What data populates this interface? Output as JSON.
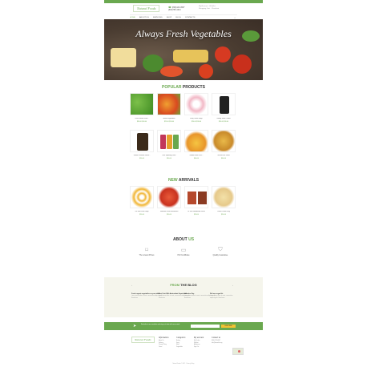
{
  "header": {
    "logo": "Natural Foods",
    "phone_lines": [
      "(800)123-4567",
      "(800)765-4321"
    ],
    "account_lines": [
      "My Account · Wishlist",
      "Shopping Cart · Checkout"
    ]
  },
  "nav": {
    "items": [
      "HOME",
      "ABOUT US",
      "SERVICES",
      "SHOP",
      "BLOG",
      "CONTACTS"
    ],
    "active_index": 0,
    "search_icon": "search-icon"
  },
  "hero": {
    "title": "Always Fresh Vegetables"
  },
  "popular": {
    "title_prefix": "POPULAR",
    "title_suffix": " PRODUCTS",
    "products": [
      {
        "name": "Peas Frozen Grow...",
        "price": "$34.00  $40.00"
      },
      {
        "name": "Mixed Vegetables",
        "price": "$25.00  $30.00"
      },
      {
        "name": "Easy Onion Rings",
        "price": "$24.00  $30.00"
      },
      {
        "name": "Grilling Steak Coffee",
        "price": "$24.00  $30.00"
      },
      {
        "name": "Safina Premium Gourd...",
        "price": "$26.00"
      },
      {
        "name": "Izze Sparkling Juice",
        "price": "$24.00"
      },
      {
        "name": "Golden Hass Pine...",
        "price": "$34.00"
      },
      {
        "name": "Gluten Free Pasta",
        "price": "$34.00"
      }
    ]
  },
  "arrivals": {
    "title_prefix": "NEW",
    "title_suffix": " ARRIVALS",
    "products": [
      {
        "name": "Fat Free Fruit Rings",
        "price": "$26.00"
      },
      {
        "name": "Valentino Pizza Mozzarella",
        "price": "$24.00"
      },
      {
        "name": "Dr Jack Handmade Pasta",
        "price": "$28.00"
      },
      {
        "name": "Penne Pasta Long",
        "price": "$24.00"
      }
    ]
  },
  "about": {
    "title_prefix": "ABOUT",
    "title_suffix": " US",
    "features": [
      {
        "icon": "tag-icon",
        "label": "The Lowest Prices"
      },
      {
        "icon": "certificate-icon",
        "label": "ISO Certificate"
      },
      {
        "icon": "shield-icon",
        "label": "Quality Guarantee"
      }
    ]
  },
  "blog": {
    "title_prefix": "FROM",
    "title_suffix": " THE BLOG",
    "posts": [
      {
        "title": "Fresh organic vegetables on your table",
        "text": "Lorem ipsum dolor sit amet, consectetur adipiscing elit. Read more"
      },
      {
        "title": "Best Fruit With Antioxidant Superfoods",
        "text": "Lorem ipsum dolor sit amet, consectetur adipiscing elit. Read more"
      },
      {
        "title": "Valentine Day",
        "text": "Lorem ipsum dolor sit amet, consectetur adipiscing elit. Read more"
      },
      {
        "title": "We love vegan life",
        "text": "Lorem ipsum dolor sit amet, consectetur adipiscing elit. Read more"
      }
    ]
  },
  "newsletter": {
    "text": "Subscribe to our newsletter and stay up to date with new arrivals",
    "placeholder": "Enter your e-mail",
    "button": "SUBSCRIBE"
  },
  "footer": {
    "logo": "Natural Foods",
    "columns": [
      {
        "title": "Information",
        "links": [
          "About Us",
          "Delivery",
          "Privacy Policy",
          "Terms"
        ]
      },
      {
        "title": "Categories",
        "links": [
          "Bakery",
          "Dairy",
          "Meat",
          "Vegetables"
        ]
      },
      {
        "title": "My account",
        "links": [
          "My Orders",
          "Wishlist",
          "Addresses",
          "Sign Out"
        ]
      },
      {
        "title": "Contact us",
        "links": [
          "(800) 123-4567",
          "info@demolink.org"
        ]
      }
    ],
    "copyright": "Natural Foods © 2017 · Privacy Policy"
  },
  "colors": {
    "accent": "#6aa84f",
    "button": "#f1c232",
    "blog_bg": "#f5f5ec"
  }
}
